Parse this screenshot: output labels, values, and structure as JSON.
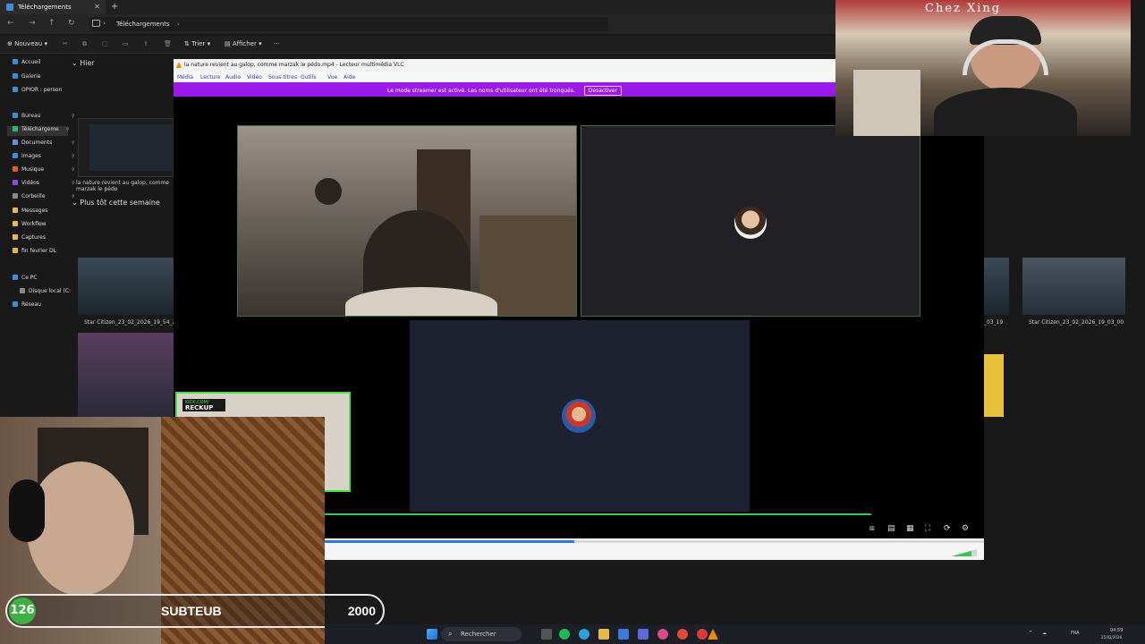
{
  "explorer": {
    "tab_title": "Téléchargements",
    "breadcrumb": "Téléchargements",
    "commands": {
      "new": "Nouveau",
      "sort": "Trier",
      "view": "Afficher"
    },
    "sidebar": [
      {
        "label": "Accueil",
        "color": "#3a8fd8"
      },
      {
        "label": "Galerie",
        "color": "#3a8fd8"
      },
      {
        "label": "OPIOR : person",
        "color": "#3a8fd8"
      },
      {
        "label": "Bureau",
        "color": "#3a8fd8"
      },
      {
        "label": "Téléchargeme",
        "color": "#2bb673"
      },
      {
        "label": "Documents",
        "color": "#6a8ed8"
      },
      {
        "label": "Images",
        "color": "#3a8fd8"
      },
      {
        "label": "Musique",
        "color": "#e35a2e"
      },
      {
        "label": "Vidéos",
        "color": "#8e4ad8"
      },
      {
        "label": "Corbeille",
        "color": "#888888"
      },
      {
        "label": "Messages",
        "color": "#e8b84a"
      },
      {
        "label": "Workflow",
        "color": "#e8b84a"
      },
      {
        "label": "Captures",
        "color": "#e8b84a"
      },
      {
        "label": "fin fevrier DL",
        "color": "#e8b84a"
      },
      {
        "label": "Ce PC",
        "color": "#3a8fd8"
      },
      {
        "label": "Disque local (C:",
        "color": "#888888"
      },
      {
        "label": "Réseau",
        "color": "#3a8fd8"
      }
    ],
    "group_yesterday": "Hier",
    "group_earlier": "Plus tôt cette semaine",
    "file_caption_1": "la nature revient au galop, comme marzak le pédo",
    "file_caption_2": "Star Citizen_23_02_2026_19_54_2",
    "file_caption_3": "Star Citizen_23_02_2026_19_03_00",
    "file_caption_4": "_03_19"
  },
  "vlc": {
    "title": "la nature revient au galop, comme marzak le pédo.mp4 - Lecteur multimédia VLC",
    "menu": [
      "Média",
      "Lecture",
      "Audio",
      "Vidéo",
      "Sous-titres",
      "Outils",
      "Vue",
      "Aide"
    ],
    "banner_text": "Le mode streamer est activé. Les noms d'utilisateur ont été tronqués.",
    "banner_button": "Désactiver",
    "progress_fraction": 0.38
  },
  "overlay": {
    "restaurant_name": "Chez Xing",
    "kick_badge_line1": "KICK.COM/",
    "kick_badge_line2": "RECKUP",
    "sub_count": "126",
    "sub_name": "SUBTEUB",
    "sub_goal": "2000"
  },
  "taskbar": {
    "search_placeholder": "Rechercher",
    "lang": "FRA",
    "time": "04:59",
    "date": "25/02/2026"
  }
}
